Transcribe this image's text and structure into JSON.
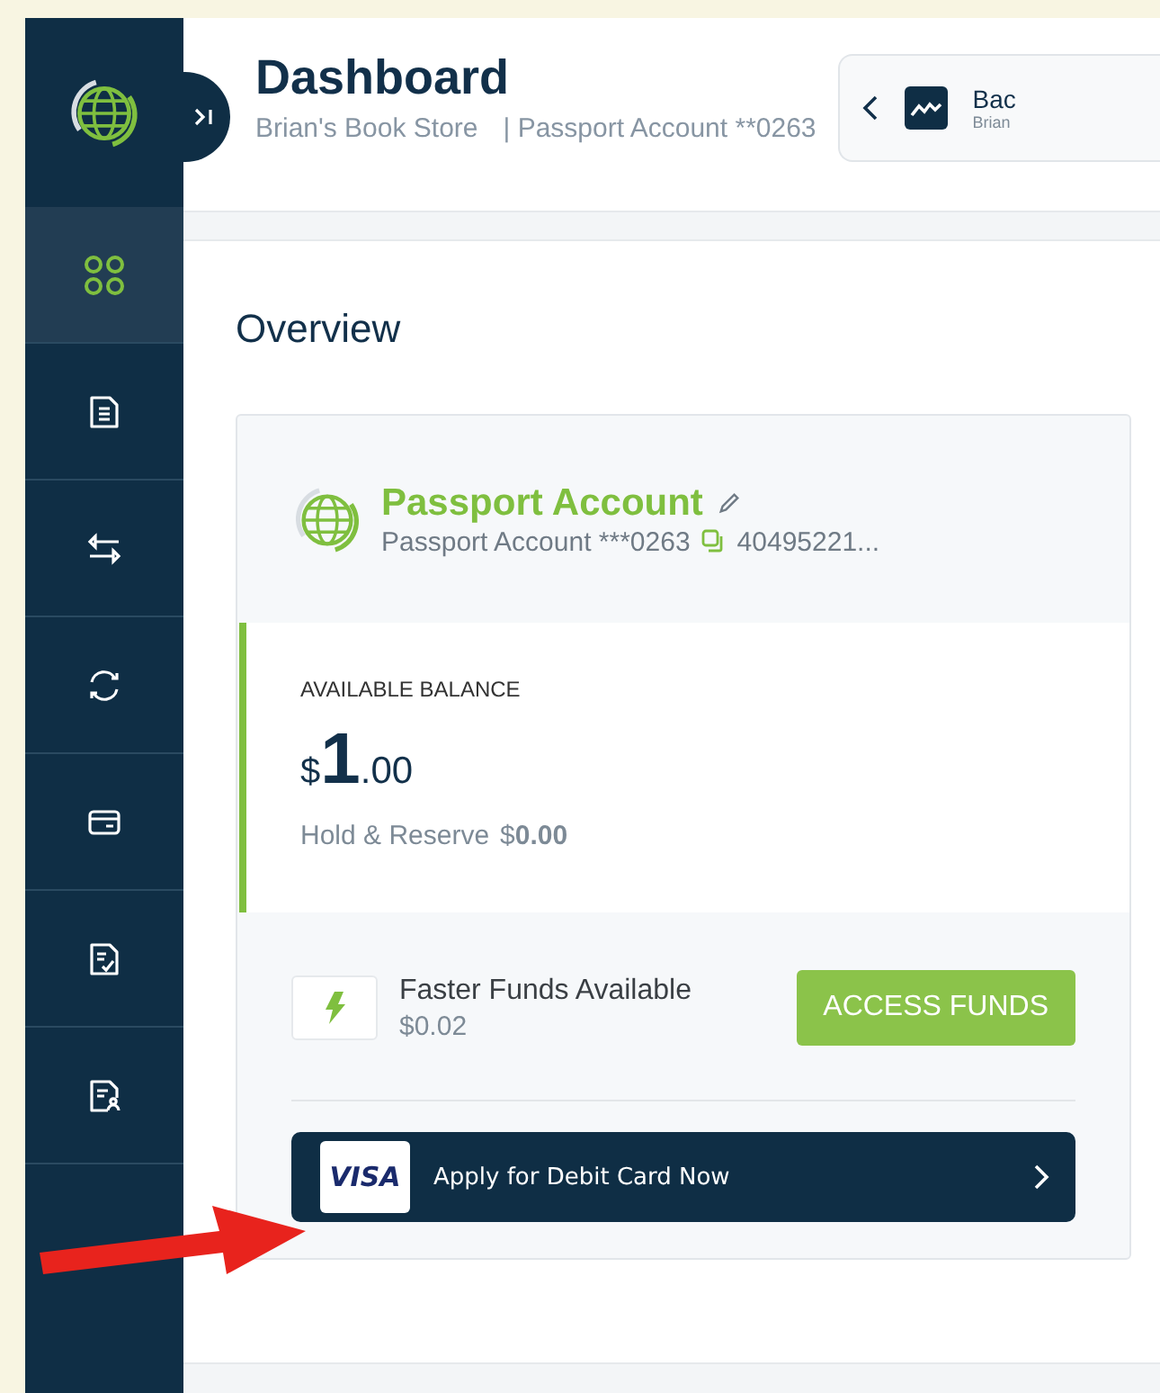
{
  "sidebar": {
    "items": [
      {
        "selected": true
      },
      {
        "selected": false
      },
      {
        "selected": false
      },
      {
        "selected": false
      },
      {
        "selected": false
      },
      {
        "selected": false
      },
      {
        "selected": false
      }
    ]
  },
  "header": {
    "title": "Dashboard",
    "business": "Brian's Book Store",
    "account": "| Passport Account **0263",
    "switcher": {
      "name": "Bac",
      "owner": "Brian"
    }
  },
  "overview": {
    "title": "Overview",
    "account": {
      "name": "Passport Account",
      "number": "Passport Account ***0263",
      "routing": "40495221...",
      "balance_label": "AVAILABLE BALANCE",
      "currency": "$",
      "whole": "1",
      "cents": ".00",
      "hold_label": "Hold & Reserve",
      "hold_value": "$**0.00**",
      "faster_title": "Faster Funds Available",
      "faster_value": "$0.02",
      "access_button": "ACCESS FUNDS",
      "debit_logo": "VISA",
      "debit_label": "Apply for Debit Card Now"
    }
  }
}
